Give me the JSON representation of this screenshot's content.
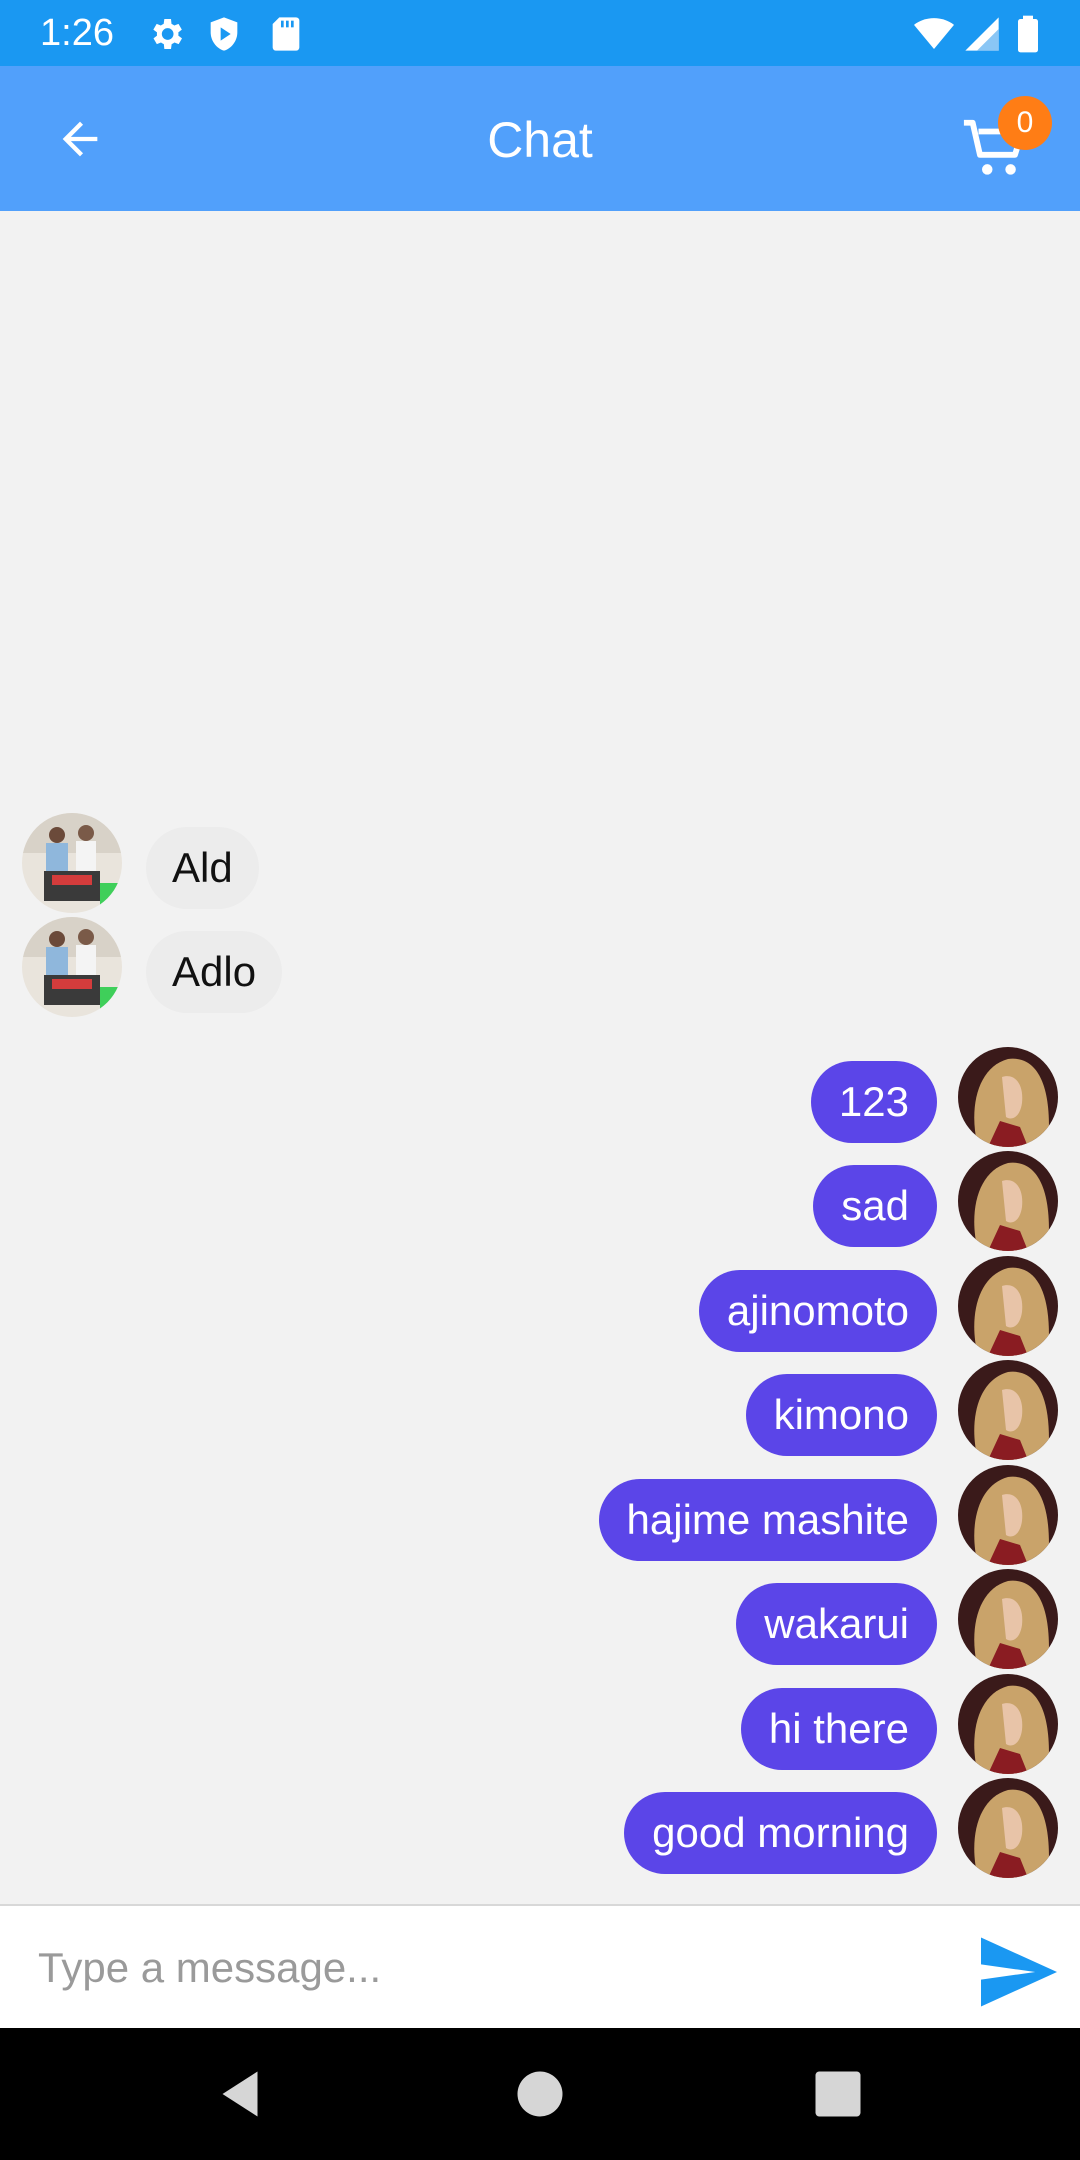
{
  "status_bar": {
    "time": "1:26",
    "icons": [
      "gear-icon",
      "shield-icon",
      "sd-card-icon",
      "wifi-icon",
      "signal-icon",
      "battery-icon"
    ]
  },
  "app_bar": {
    "title": "Chat",
    "cart_count": "0",
    "colors": {
      "status_bar": "#1a98f2",
      "app_bar": "#51a0fb",
      "badge": "#ff7d15"
    }
  },
  "chat": {
    "incoming": [
      {
        "text": "Ald"
      },
      {
        "text": "Adlo"
      }
    ],
    "outgoing": [
      {
        "text": "123"
      },
      {
        "text": "sad"
      },
      {
        "text": "ajinomoto"
      },
      {
        "text": "kimono"
      },
      {
        "text": "hajime mashite"
      },
      {
        "text": "wakarui"
      },
      {
        "text": "hi there"
      },
      {
        "text": "good morning"
      }
    ],
    "colors": {
      "outgoing_bubble": "#5b45e8",
      "incoming_bubble": "#ececec"
    }
  },
  "input": {
    "placeholder": "Type a message...",
    "value": ""
  }
}
